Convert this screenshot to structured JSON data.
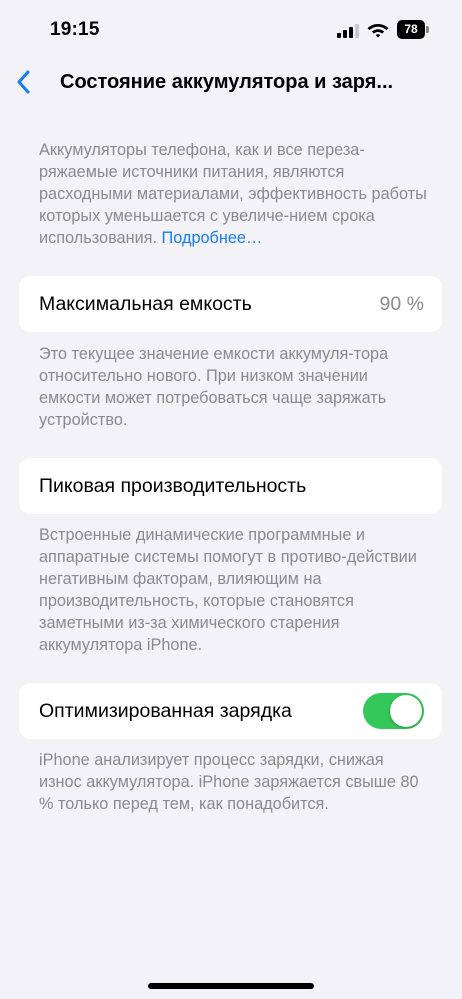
{
  "status_bar": {
    "time": "19:15",
    "battery_level": "78",
    "icons": [
      "signal-icon",
      "wifi-icon",
      "battery-icon"
    ]
  },
  "nav": {
    "back_icon": "chevron-left-icon",
    "title": "Состояние аккумулятора и заря..."
  },
  "intro": {
    "text": "Аккумуляторы телефона, как и все переза-ряжаемые источники питания, являются расходными материалами, эффективность работы которых уменьшается с увеличе-нием срока использования. ",
    "link": "Подробнее…"
  },
  "max_capacity": {
    "label": "Максимальная емкость",
    "value": "90 %",
    "footnote": "Это текущее значение емкости аккумуля-тора относительно нового. При низком значении емкости может потребоваться чаще заряжать устройство."
  },
  "peak_performance": {
    "label": "Пиковая производительность",
    "footnote": "Встроенные динамические программные и аппаратные системы помогут в противо-действии негативным факторам, влияющим на производительность, которые становятся заметными из-за химического старения аккумулятора iPhone."
  },
  "optimized_charging": {
    "label": "Оптимизированная зарядка",
    "enabled": true,
    "footnote": "iPhone анализирует процесс зарядки, снижая износ аккумулятора. iPhone заряжается свыше 80 % только перед тем, как понадобится."
  },
  "colors": {
    "background": "#f2f2f7",
    "accent": "#1a7cf3",
    "toggle_on": "#34c759",
    "secondary_text": "#8a8a8e"
  }
}
